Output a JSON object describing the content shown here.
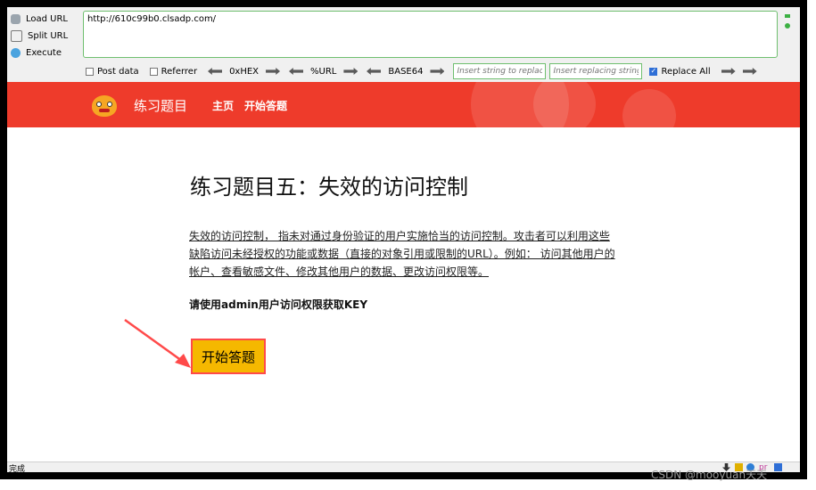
{
  "toolbar": {
    "load_url": "Load URL",
    "split_url": "Split URL",
    "execute": "Execute",
    "url_value": "http://610c99b0.clsadp.com/",
    "post_data": "Post data",
    "referrer": "Referrer",
    "hex": "0xHEX",
    "url_enc": "%URL",
    "base64": "BASE64",
    "insert_string_placeholder": "Insert string to replace",
    "insert_replacing_placeholder": "Insert replacing string",
    "replace_all": "Replace All"
  },
  "header": {
    "brand": "练习题目",
    "nav": [
      "主页",
      "开始答题"
    ],
    "color": "#ee3b2b"
  },
  "content": {
    "title": "练习题目五：失效的访问控制",
    "description": "失效的访问控制， 指未对通过身份验证的用户实施恰当的访问控制。攻击者可以利用这些缺陷访问未经授权的功能或数据（直接的对象引用或限制的URL）。例如： 访问其他用户的帐户、查看敏感文件、修改其他用户的数据、更改访问权限等。",
    "note": "请使用admin用户访问权限获取KEY",
    "start_button": "开始答题"
  },
  "status": {
    "text": "完成"
  },
  "watermark": "CSDN @mooyuan天天"
}
